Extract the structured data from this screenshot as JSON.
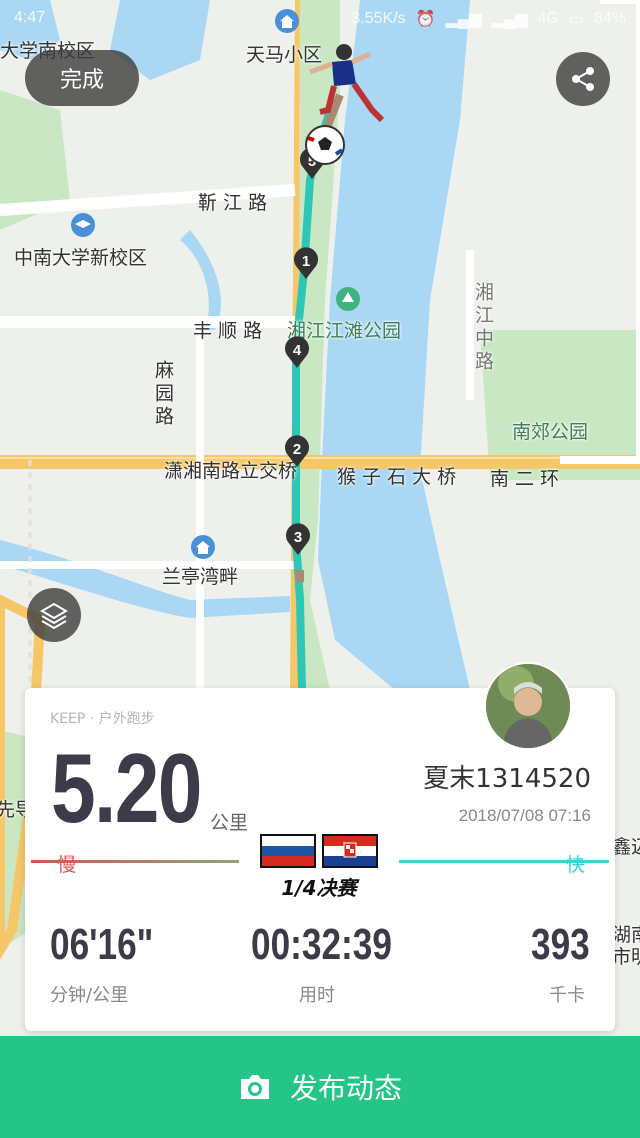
{
  "status_bar": {
    "time": "4:47",
    "speed": "3.55K/s",
    "network": "4G",
    "battery": "84%"
  },
  "map": {
    "labels": {
      "school1": "大学南校区",
      "tianma": "天马小区",
      "xinjiang": "靳 江 路",
      "zhongnan": "中南大学新校区",
      "fengshun": "丰 顺 路",
      "park": "湘江江滩公园",
      "mayuan": "麻园路",
      "xiaoxiang_bridge": "潇湘南路立交桥",
      "houzishi": "猴 子 石 大 桥",
      "ring": "南 二 环",
      "xiangjiang_road": "湘江中路",
      "nanjiao": "南郊公园",
      "lanting": "兰亭湾畔",
      "xianfeng": "先导",
      "xinjin": "鑫迈",
      "hunan": "湖南",
      "shiming": "市明"
    },
    "km_markers": [
      "1",
      "2",
      "3",
      "4",
      "5"
    ]
  },
  "buttons": {
    "done": "完成",
    "publish": "发布动态"
  },
  "card": {
    "source": "KEEP · 户外跑步",
    "distance": "5.20",
    "distance_unit": "公里",
    "username": "夏末1314520",
    "datetime": "2018/07/08 07:16",
    "pace_slow": "慢",
    "pace_fast": "快",
    "badge_text": "1/4决赛",
    "stats": [
      {
        "value": "06'16\"",
        "label": "分钟/公里"
      },
      {
        "value": "00:32:39",
        "label": "用时"
      },
      {
        "value": "393",
        "label": "千卡"
      }
    ]
  },
  "colors": {
    "route": "#2ec7b7",
    "publish": "#25c487",
    "river": "#a9d7f4",
    "park": "#c9e7c3"
  }
}
